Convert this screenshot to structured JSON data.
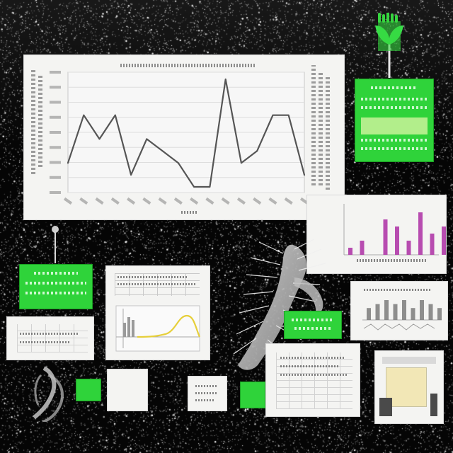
{
  "colors": {
    "background": "#050505",
    "panel": "#f4f4f2",
    "green": "#2fd33a",
    "line": "#555555",
    "bars_purple": "#b03aa8",
    "curve_yellow": "#e6cf3a"
  },
  "icons": {
    "fern": "fern-creature-illustration",
    "seedling": "seedling-icon",
    "root": "root-illustration",
    "pin": "pin-icon"
  },
  "main_chart": {
    "series": [
      {
        "values": [
          2,
          6,
          4,
          6,
          1,
          4,
          3,
          2,
          0,
          0,
          9,
          2,
          3,
          6,
          6,
          1
        ]
      }
    ]
  },
  "bars_chart": {
    "values": [
      1,
      2,
      0,
      5,
      4,
      2,
      6,
      3,
      4
    ]
  },
  "mini_bars": {
    "values": [
      3,
      4,
      5,
      4,
      5,
      3,
      5,
      4,
      3
    ]
  }
}
